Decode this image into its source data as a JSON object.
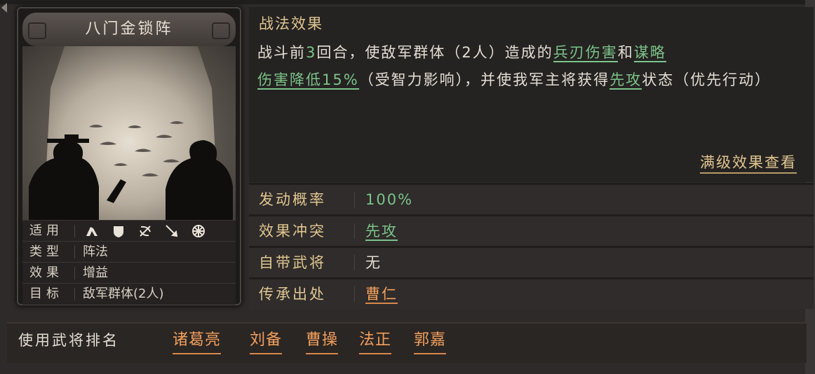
{
  "card": {
    "name": "八门金锁阵",
    "stats": [
      {
        "key": "适用",
        "value": ""
      },
      {
        "key": "类型",
        "value": "阵法"
      },
      {
        "key": "效果",
        "value": "增益"
      },
      {
        "key": "目标",
        "value": "敌军群体(2人)"
      }
    ],
    "unit_icons": [
      "cavalry-icon",
      "shield-icon",
      "bow-icon",
      "spear-icon",
      "wheel-icon"
    ]
  },
  "effect": {
    "title": "战法效果",
    "segments": [
      {
        "text": "战斗前",
        "style": "plain"
      },
      {
        "text": "3",
        "style": "num"
      },
      {
        "text": "回合，使敌军群体（2人）造成的",
        "style": "plain"
      },
      {
        "text": "兵刃伤害",
        "style": "link"
      },
      {
        "text": "和",
        "style": "plain"
      },
      {
        "text": "谋略",
        "style": "link"
      },
      {
        "text": "伤害降低15%",
        "style": "link"
      },
      {
        "text": "（受智力影响），并使我军主将获得",
        "style": "plain"
      },
      {
        "text": "先攻",
        "style": "link"
      },
      {
        "text": "状态（优先行动）",
        "style": "plain"
      }
    ],
    "full_link": "满级效果查看"
  },
  "rows": [
    {
      "key": "发动概率",
      "value": "100%"
    },
    {
      "key": "效果冲突",
      "value": "先攻"
    },
    {
      "key": "自带武将",
      "value": "无"
    },
    {
      "key": "传承出处",
      "value": "曹仁"
    }
  ],
  "ranking": {
    "label": "使用武将排名",
    "generals": [
      "诸葛亮",
      "刘备",
      "曹操",
      "法正",
      "郭嘉"
    ]
  },
  "colors": {
    "gold_text": "#e0c690",
    "green_text": "#7bc389",
    "orange_text": "#f39f5b",
    "body_text": "#e3ddd3"
  }
}
